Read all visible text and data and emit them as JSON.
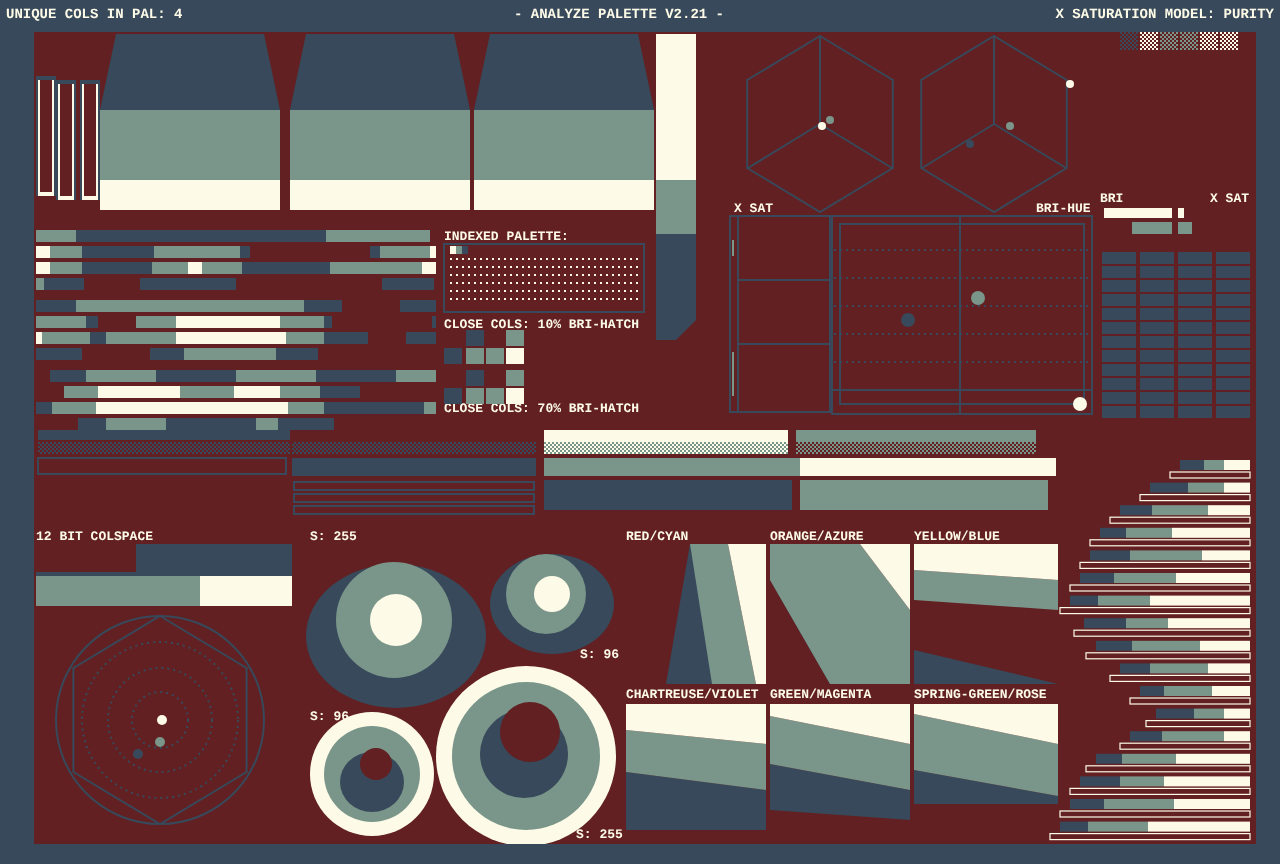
{
  "header": {
    "left": "UNIQUE COLS IN PAL: 4",
    "title": "- ANALYZE PALETTE V2.21 -",
    "right": "X SATURATION MODEL: PURITY"
  },
  "swatches": [
    {
      "color": "#37495a"
    },
    {
      "color": "#fdfbe8"
    },
    {
      "color": "#7a958a"
    },
    {
      "color": "#7a958a"
    },
    {
      "color": "#fdfbe8"
    },
    {
      "color": "#fdfbe8"
    }
  ],
  "indexed_palette": {
    "label": "INDEXED PALETTE:",
    "entries": [
      {
        "color": "#fdfbe8"
      },
      {
        "color": "#7a958a"
      },
      {
        "color": "#37495a"
      }
    ]
  },
  "close_cols": [
    {
      "label": "CLOSE COLS: 10% BRI-HATCH"
    },
    {
      "label": "CLOSE COLS: 70% BRI-HATCH"
    }
  ],
  "sat_panel": {
    "label": "X SAT"
  },
  "bri_hue_panel": {
    "label": "BRI-HUE"
  },
  "bri_table": {
    "left_label": "BRI",
    "right_label": "X SAT"
  },
  "colspace": {
    "label": "12 BIT COLSPACE"
  },
  "rings": [
    {
      "label": "S: 255"
    },
    {
      "label": "S: 96"
    },
    {
      "label": "S: 96"
    },
    {
      "label": "S: 255"
    }
  ],
  "hue_pairs": [
    {
      "label": "RED/CYAN"
    },
    {
      "label": "ORANGE/AZURE"
    },
    {
      "label": "YELLOW/BLUE"
    },
    {
      "label": "CHARTREUSE/VIOLET"
    },
    {
      "label": "GREEN/MAGENTA"
    },
    {
      "label": "SPRING-GREEN/ROSE"
    }
  ]
}
